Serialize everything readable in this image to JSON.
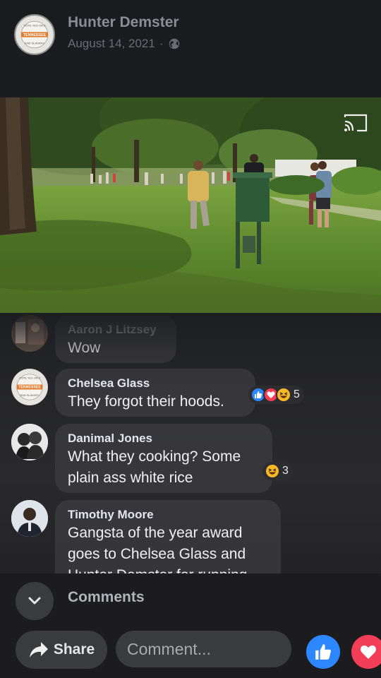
{
  "post": {
    "author": "Hunter Demster",
    "date": "August 14, 2021",
    "separator": "·",
    "privacy_icon": "globe-icon"
  },
  "comments": [
    {
      "name": "Aaron J Litzsey",
      "text": "Wow"
    },
    {
      "name": "Chelsea Glass",
      "text": "They forgot their hoods.",
      "reactions": [
        "like",
        "love",
        "haha"
      ],
      "reaction_count": "5"
    },
    {
      "name": "Danimal Jones",
      "text_line1": "What they cooking? Some",
      "text_line2": "plain ass white rice",
      "reactions": [
        "haha"
      ],
      "reaction_count": "3"
    },
    {
      "name": "Timothy Moore",
      "text_line1": "Gangsta of the year award",
      "text_line2": "goes to Chelsea Glass and",
      "text_line3": "Hunter Demster for running"
    }
  ],
  "footer": {
    "comments_label": "Comments",
    "share_label": "Share",
    "comment_placeholder": "Comment..."
  },
  "badge": {
    "top_text": "VOTE YES ON 3",
    "middle_text": "TENNESSEE",
    "bottom_text": "END SLAVERY"
  },
  "colors": {
    "like_blue": "#2d88ff",
    "love_red": "#f33e58",
    "haha_yellow": "#f7b928"
  }
}
